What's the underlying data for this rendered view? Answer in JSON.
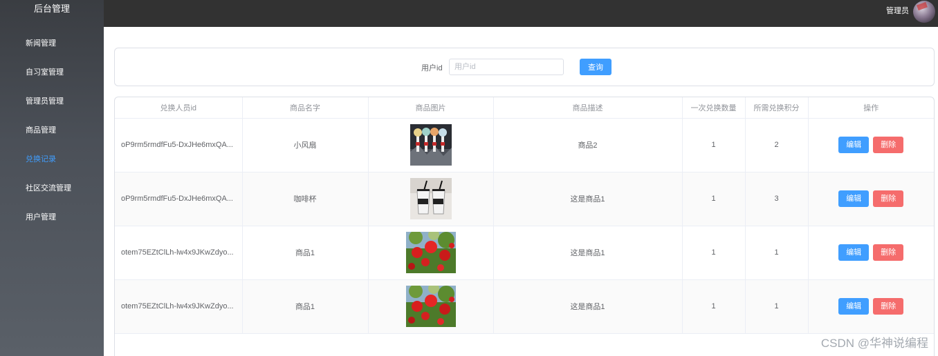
{
  "sidebar": {
    "title": "后台管理",
    "items": [
      {
        "label": "新闻管理",
        "active": false
      },
      {
        "label": "自习室管理",
        "active": false
      },
      {
        "label": "管理员管理",
        "active": false
      },
      {
        "label": "商品管理",
        "active": false
      },
      {
        "label": "兑换记录",
        "active": true
      },
      {
        "label": "社区交流管理",
        "active": false
      },
      {
        "label": "用户管理",
        "active": false
      }
    ]
  },
  "header": {
    "user_name": "管理员"
  },
  "search": {
    "label": "用户id",
    "placeholder": "用户id",
    "value": "",
    "query_label": "查询"
  },
  "table": {
    "columns": [
      "兑换人员id",
      "商品名字",
      "商品图片",
      "商品描述",
      "一次兑换数量",
      "所需兑换积分",
      "操作"
    ],
    "rows": [
      {
        "user_id": "oP9rm5rmdfFu5-DxJHe6mxQA...",
        "name": "小风扇",
        "image": "fans-photo",
        "desc": "商品2",
        "qty": "1",
        "points": "2"
      },
      {
        "user_id": "oP9rm5rmdfFu5-DxJHe6mxQA...",
        "name": "咖啡杯",
        "image": "cups-photo",
        "desc": "这是商品1",
        "qty": "1",
        "points": "3"
      },
      {
        "user_id": "otem75EZtClLh-lw4x9JKwZdyo...",
        "name": "商品1",
        "image": "flowers-photo",
        "desc": "这是商品1",
        "qty": "1",
        "points": "1"
      },
      {
        "user_id": "otem75EZtClLh-lw4x9JKwZdyo...",
        "name": "商品1",
        "image": "flowers-photo",
        "desc": "这是商品1",
        "qty": "1",
        "points": "1"
      }
    ],
    "edit_label": "编辑",
    "delete_label": "删除"
  },
  "watermark": "CSDN @华神说编程",
  "colors": {
    "accent": "#409eff",
    "danger": "#f56c6c",
    "topbar": "#323232",
    "sidebar": "#4b5058"
  }
}
